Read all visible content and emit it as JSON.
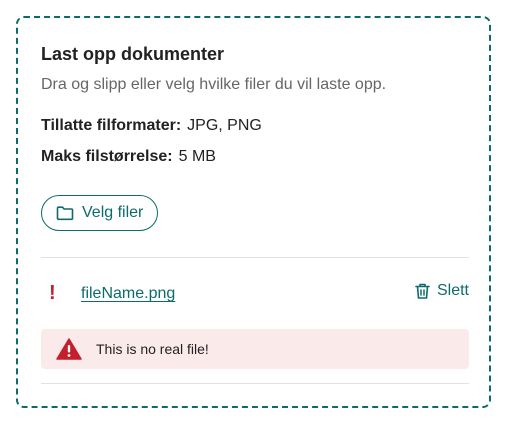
{
  "uploader": {
    "title": "Last opp dokumenter",
    "description": "Dra og slipp eller velg hvilke filer du vil laste opp.",
    "formats_label": "Tillatte filformater:",
    "formats_value": "JPG, PNG",
    "maxsize_label": "Maks filstørrelse:",
    "maxsize_value": "5 MB",
    "select_button_label": "Velg filer",
    "select_icon": "folder-icon"
  },
  "file": {
    "status_icon": "!",
    "name": "fileName.png",
    "delete_label": "Slett",
    "delete_icon": "trash-icon",
    "error_icon": "warning-triangle-icon",
    "error_text": "This is no real file!"
  },
  "colors": {
    "accent": "#0e6b6b",
    "error": "#c3202b",
    "error_bg": "#fbeaea"
  }
}
